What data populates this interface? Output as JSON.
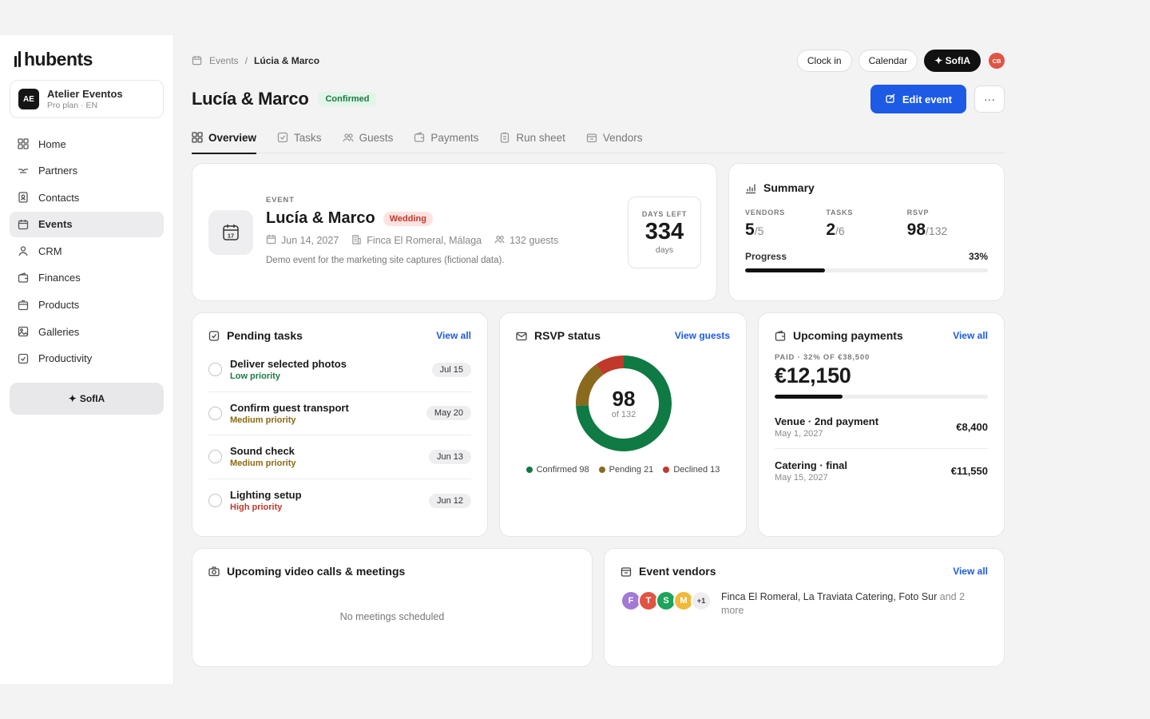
{
  "sidebar": {
    "logo": "hubents",
    "workspace": {
      "initials": "AE",
      "name": "Atelier Eventos",
      "plan": "Pro plan · EN"
    },
    "items": [
      {
        "label": "Home",
        "icon": "grid-icon"
      },
      {
        "label": "Partners",
        "icon": "handshake-icon"
      },
      {
        "label": "Contacts",
        "icon": "contact-icon"
      },
      {
        "label": "Events",
        "icon": "calendar-icon",
        "active": true
      },
      {
        "label": "CRM",
        "icon": "user-icon"
      },
      {
        "label": "Finances",
        "icon": "wallet-icon"
      },
      {
        "label": "Products",
        "icon": "box-icon"
      },
      {
        "label": "Galleries",
        "icon": "image-icon"
      },
      {
        "label": "Productivity",
        "icon": "check-icon"
      }
    ],
    "sofia_label": "SofIA",
    "sofia_icon": "✦"
  },
  "topbar": {
    "breadcrumb": {
      "parent": "Events",
      "sep": "/",
      "current": "Lúcia & Marco"
    },
    "clock_in": "Clock in",
    "calendar": "Calendar",
    "sofia": "✦ SofIA",
    "user_initials": "CB"
  },
  "header": {
    "title": "Lucía & Marco",
    "status": "Confirmed",
    "edit_label": "Edit event",
    "more": "···"
  },
  "tabs": [
    "Overview",
    "Tasks",
    "Guests",
    "Payments",
    "Run sheet",
    "Vendors"
  ],
  "event_card": {
    "eyebrow": "EVENT",
    "name": "Lucía & Marco",
    "type": "Wedding",
    "date": "Jun 14, 2027",
    "venue": "Finca El Romeral, Málaga",
    "guests": "132 guests",
    "description": "Demo event for the marketing site captures (fictional data).",
    "calendar_day": "17",
    "days_left_label": "DAYS LEFT",
    "days_left_value": "334",
    "days_unit": "days"
  },
  "summary": {
    "title": "Summary",
    "stats": [
      {
        "label": "VENDORS",
        "value": "5",
        "total": "/5"
      },
      {
        "label": "TASKS",
        "value": "2",
        "total": "/6"
      },
      {
        "label": "RSVP",
        "value": "98",
        "total": "/132"
      }
    ],
    "progress_label": "Progress",
    "progress_text": "33%",
    "progress_value": 0.33
  },
  "pending_tasks": {
    "title": "Pending tasks",
    "link": "View all",
    "items": [
      {
        "name": "Deliver selected photos",
        "priority": "Low priority",
        "date": "Jul 15"
      },
      {
        "name": "Confirm guest transport",
        "priority": "Medium priority",
        "date": "May 20"
      },
      {
        "name": "Sound check",
        "priority": "Medium priority",
        "date": "Jun 13"
      },
      {
        "name": "Lighting setup",
        "priority": "High priority",
        "date": "Jun 12"
      }
    ],
    "priority_colors": {
      "Low priority": "#1c7a43",
      "Medium priority": "#8a6a12",
      "High priority": "#c0392b"
    }
  },
  "rsvp": {
    "title": "RSVP status",
    "link": "View guests",
    "center_value": "98",
    "center_sub": "of 132",
    "segments": [
      {
        "label": "Confirmed",
        "value": 98,
        "color": "#0f7a43"
      },
      {
        "label": "Pending",
        "value": 21,
        "color": "#8a6a1c"
      },
      {
        "label": "Declined",
        "value": 13,
        "color": "#c0392b"
      }
    ],
    "legend": [
      "Confirmed 98",
      "Pending 21",
      "Declined 13"
    ]
  },
  "payments": {
    "title": "Upcoming payments",
    "link": "View all",
    "paid_label": "PAID · 32% OF €38,500",
    "paid_amount": "€12,150",
    "paid_fraction": 0.32,
    "items": [
      {
        "name": "Venue · 2nd payment",
        "date": "May 1, 2027",
        "amount": "€8,400"
      },
      {
        "name": "Catering · final",
        "date": "May 15, 2027",
        "amount": "€11,550"
      }
    ]
  },
  "meetings": {
    "title": "Upcoming video calls & meetings",
    "empty": "No meetings scheduled"
  },
  "vendors": {
    "title": "Event vendors",
    "link": "View all",
    "avatars": [
      {
        "letter": "F",
        "color": "#a07ad6"
      },
      {
        "letter": "T",
        "color": "#e15444"
      },
      {
        "letter": "S",
        "color": "#1fa35a"
      },
      {
        "letter": "M",
        "color": "#f0b93a"
      }
    ],
    "more_badge": "+1",
    "names": "Finca El Romeral, La Traviata Catering, Foto Sur",
    "names_more": "and 2 more"
  }
}
